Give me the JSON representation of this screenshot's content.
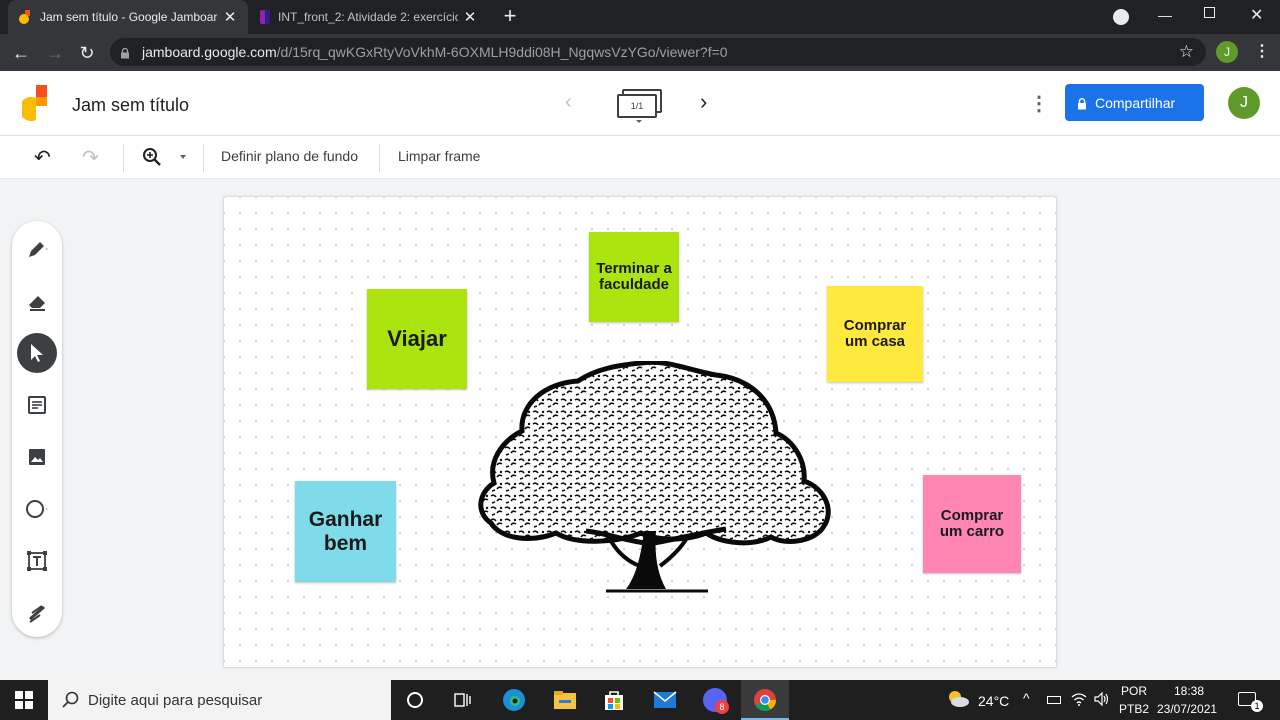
{
  "browser": {
    "tabs": [
      {
        "title": "Jam sem título - Google Jamboard",
        "active": true
      },
      {
        "title": "INT_front_2: Atividade 2: exercício",
        "active": false
      }
    ],
    "new_tab": "+",
    "url_host": "jamboard.google.com",
    "url_path": "/d/15rq_qwKGxRtyVoVkhM-6OXMLH9ddi08H_NgqwsVzYGo/viewer?f=0",
    "profile_initial": "J"
  },
  "app": {
    "title": "Jam sem título",
    "frame_indicator": "1/1",
    "share_label": "Compartilhar",
    "avatar_initial": "J",
    "accent": "#1a73e8"
  },
  "toolbar": {
    "background_label": "Definir plano de fundo",
    "clear_label": "Limpar frame"
  },
  "notes": [
    {
      "text": "Viajar",
      "color": "#ace40f"
    },
    {
      "text": "Terminar a faculdade",
      "color": "#ace40f"
    },
    {
      "text": "Comprar um casa",
      "color": "#ffe93d"
    },
    {
      "text": "Ganhar bem",
      "color": "#7fdbea"
    },
    {
      "text": "Comprar um carro",
      "color": "#ff86b2"
    }
  ],
  "taskbar": {
    "search_placeholder": "Digite aqui para pesquisar",
    "weather": "24°C",
    "lang1": "POR",
    "lang2": "PTB2",
    "time": "18:38",
    "date": "23/07/2021",
    "discord_badge": "8",
    "notification_count": "1"
  }
}
